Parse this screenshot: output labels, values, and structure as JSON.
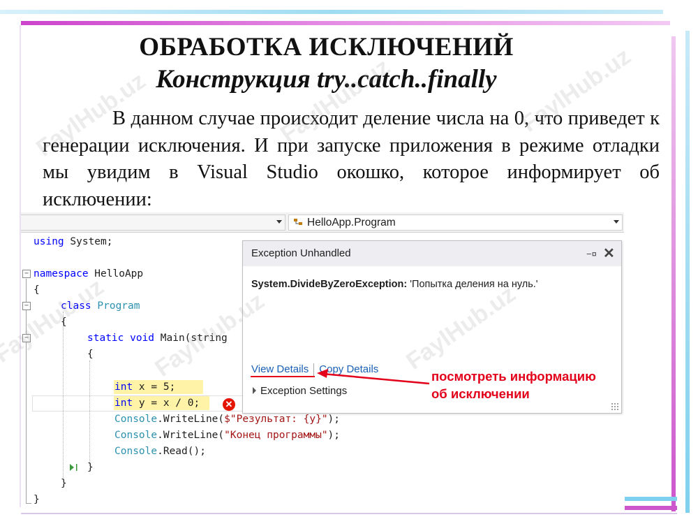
{
  "slide": {
    "title": "ОБРАБОТКА ИСКЛЮЧЕНИЙ",
    "subtitle": "Конструкция try..catch..finally",
    "paragraph": "В данном случае происходит деление числа на 0, что приведет к генерации исключения. И при запуске приложения в режиме отладки мы увидим в Visual Studio окошко, которое информирует об исключении:",
    "watermark": "FaylHub.uz"
  },
  "editor": {
    "nav_right_label": "HelloApp.Program",
    "code": {
      "l1_kw": "using",
      "l1_rest": " System;",
      "l2_kw": "namespace",
      "l2_rest": " HelloApp",
      "brace_open": "{",
      "brace_close": "}",
      "l4_kw": "class",
      "l4_type": "Program",
      "l6_kw": "static void",
      "l6_rest": " Main(string",
      "l8_kw": "int",
      "l8_rest": " x = 5;",
      "l9_kw": "int",
      "l9_rest": " y = x / 0;",
      "l10_type": "Console",
      "l10_rest": ".WriteLine(",
      "l10_str": "$\"Результат: {y}\"",
      "l10_end": ");",
      "l11_type": "Console",
      "l11_rest": ".WriteLine(",
      "l11_str": "\"Конец программы\"",
      "l11_end": ");",
      "l12_type": "Console",
      "l12_rest": ".Read();"
    }
  },
  "popup": {
    "title": "Exception Unhandled",
    "exception_type": "System.DivideByZeroException:",
    "exception_message": " 'Попытка деления на нуль.'",
    "view_details": "View Details",
    "copy_details": "Copy Details",
    "settings": "Exception Settings"
  },
  "annotation": {
    "line1": "посмотреть информацию",
    "line2": "об исключении",
    "color": "#e2001a"
  }
}
